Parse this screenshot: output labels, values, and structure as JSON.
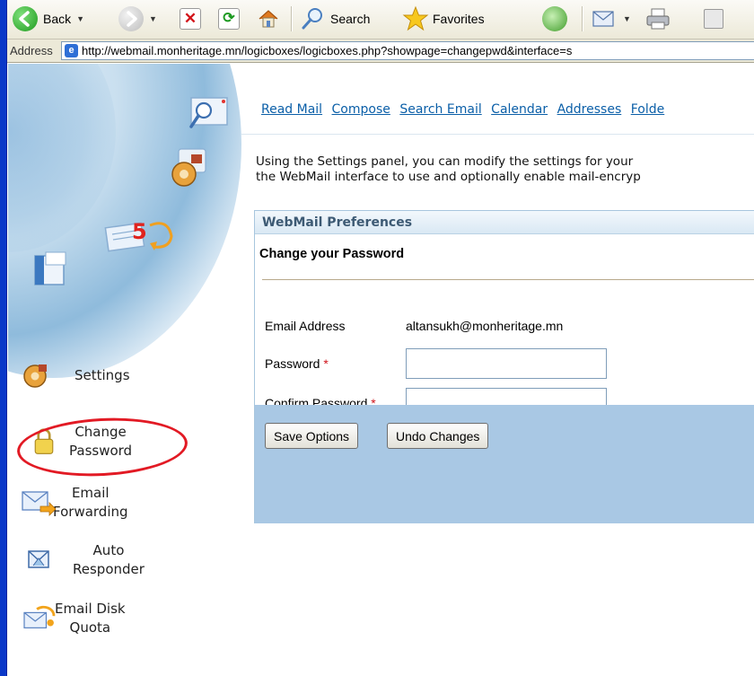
{
  "browser": {
    "toolbar": {
      "back_label": "Back",
      "search_label": "Search",
      "favorites_label": "Favorites"
    },
    "address_label": "Address",
    "address_url": "http://webmail.monheritage.mn/logicboxes/logicboxes.php?showpage=changepwd&interface=s"
  },
  "sidebar": {
    "badge_number": "5",
    "items": [
      {
        "label": "Settings",
        "icon": "gear-icon"
      },
      {
        "label_line1": "Change",
        "label_line2": "Password",
        "icon": "lock-icon"
      },
      {
        "label_line1": "Email",
        "label_line2": "Forwarding",
        "icon": "envelope-arrow-icon"
      },
      {
        "label_line1": "Auto",
        "label_line2": "Responder",
        "icon": "auto-responder-icon"
      },
      {
        "label_line1": "Email Disk",
        "label_line2": "Quota",
        "icon": "disk-quota-icon"
      }
    ],
    "highlight_color": "#e21a24"
  },
  "topnav": {
    "links": [
      "Read Mail",
      "Compose",
      "Search Email",
      "Calendar",
      "Addresses",
      "Folde"
    ]
  },
  "intro": {
    "line1": "Using the Settings panel, you can modify the settings for your",
    "line2": "the WebMail interface to use and optionally enable mail-encryp"
  },
  "panel": {
    "header": "WebMail Preferences",
    "subtitle": "Change your Password",
    "email_label": "Email Address",
    "email_value": "altansukh@monheritage.mn",
    "password_label": "Password",
    "confirm_label": "Confirm Password",
    "required_mark": "*",
    "password_value": "",
    "confirm_value": "",
    "save_button": "Save Options",
    "undo_button": "Undo Changes"
  },
  "colors": {
    "link": "#0b5fa8",
    "panel_bar": "#a9c8e4",
    "panel_header_text": "#3d5a74"
  }
}
